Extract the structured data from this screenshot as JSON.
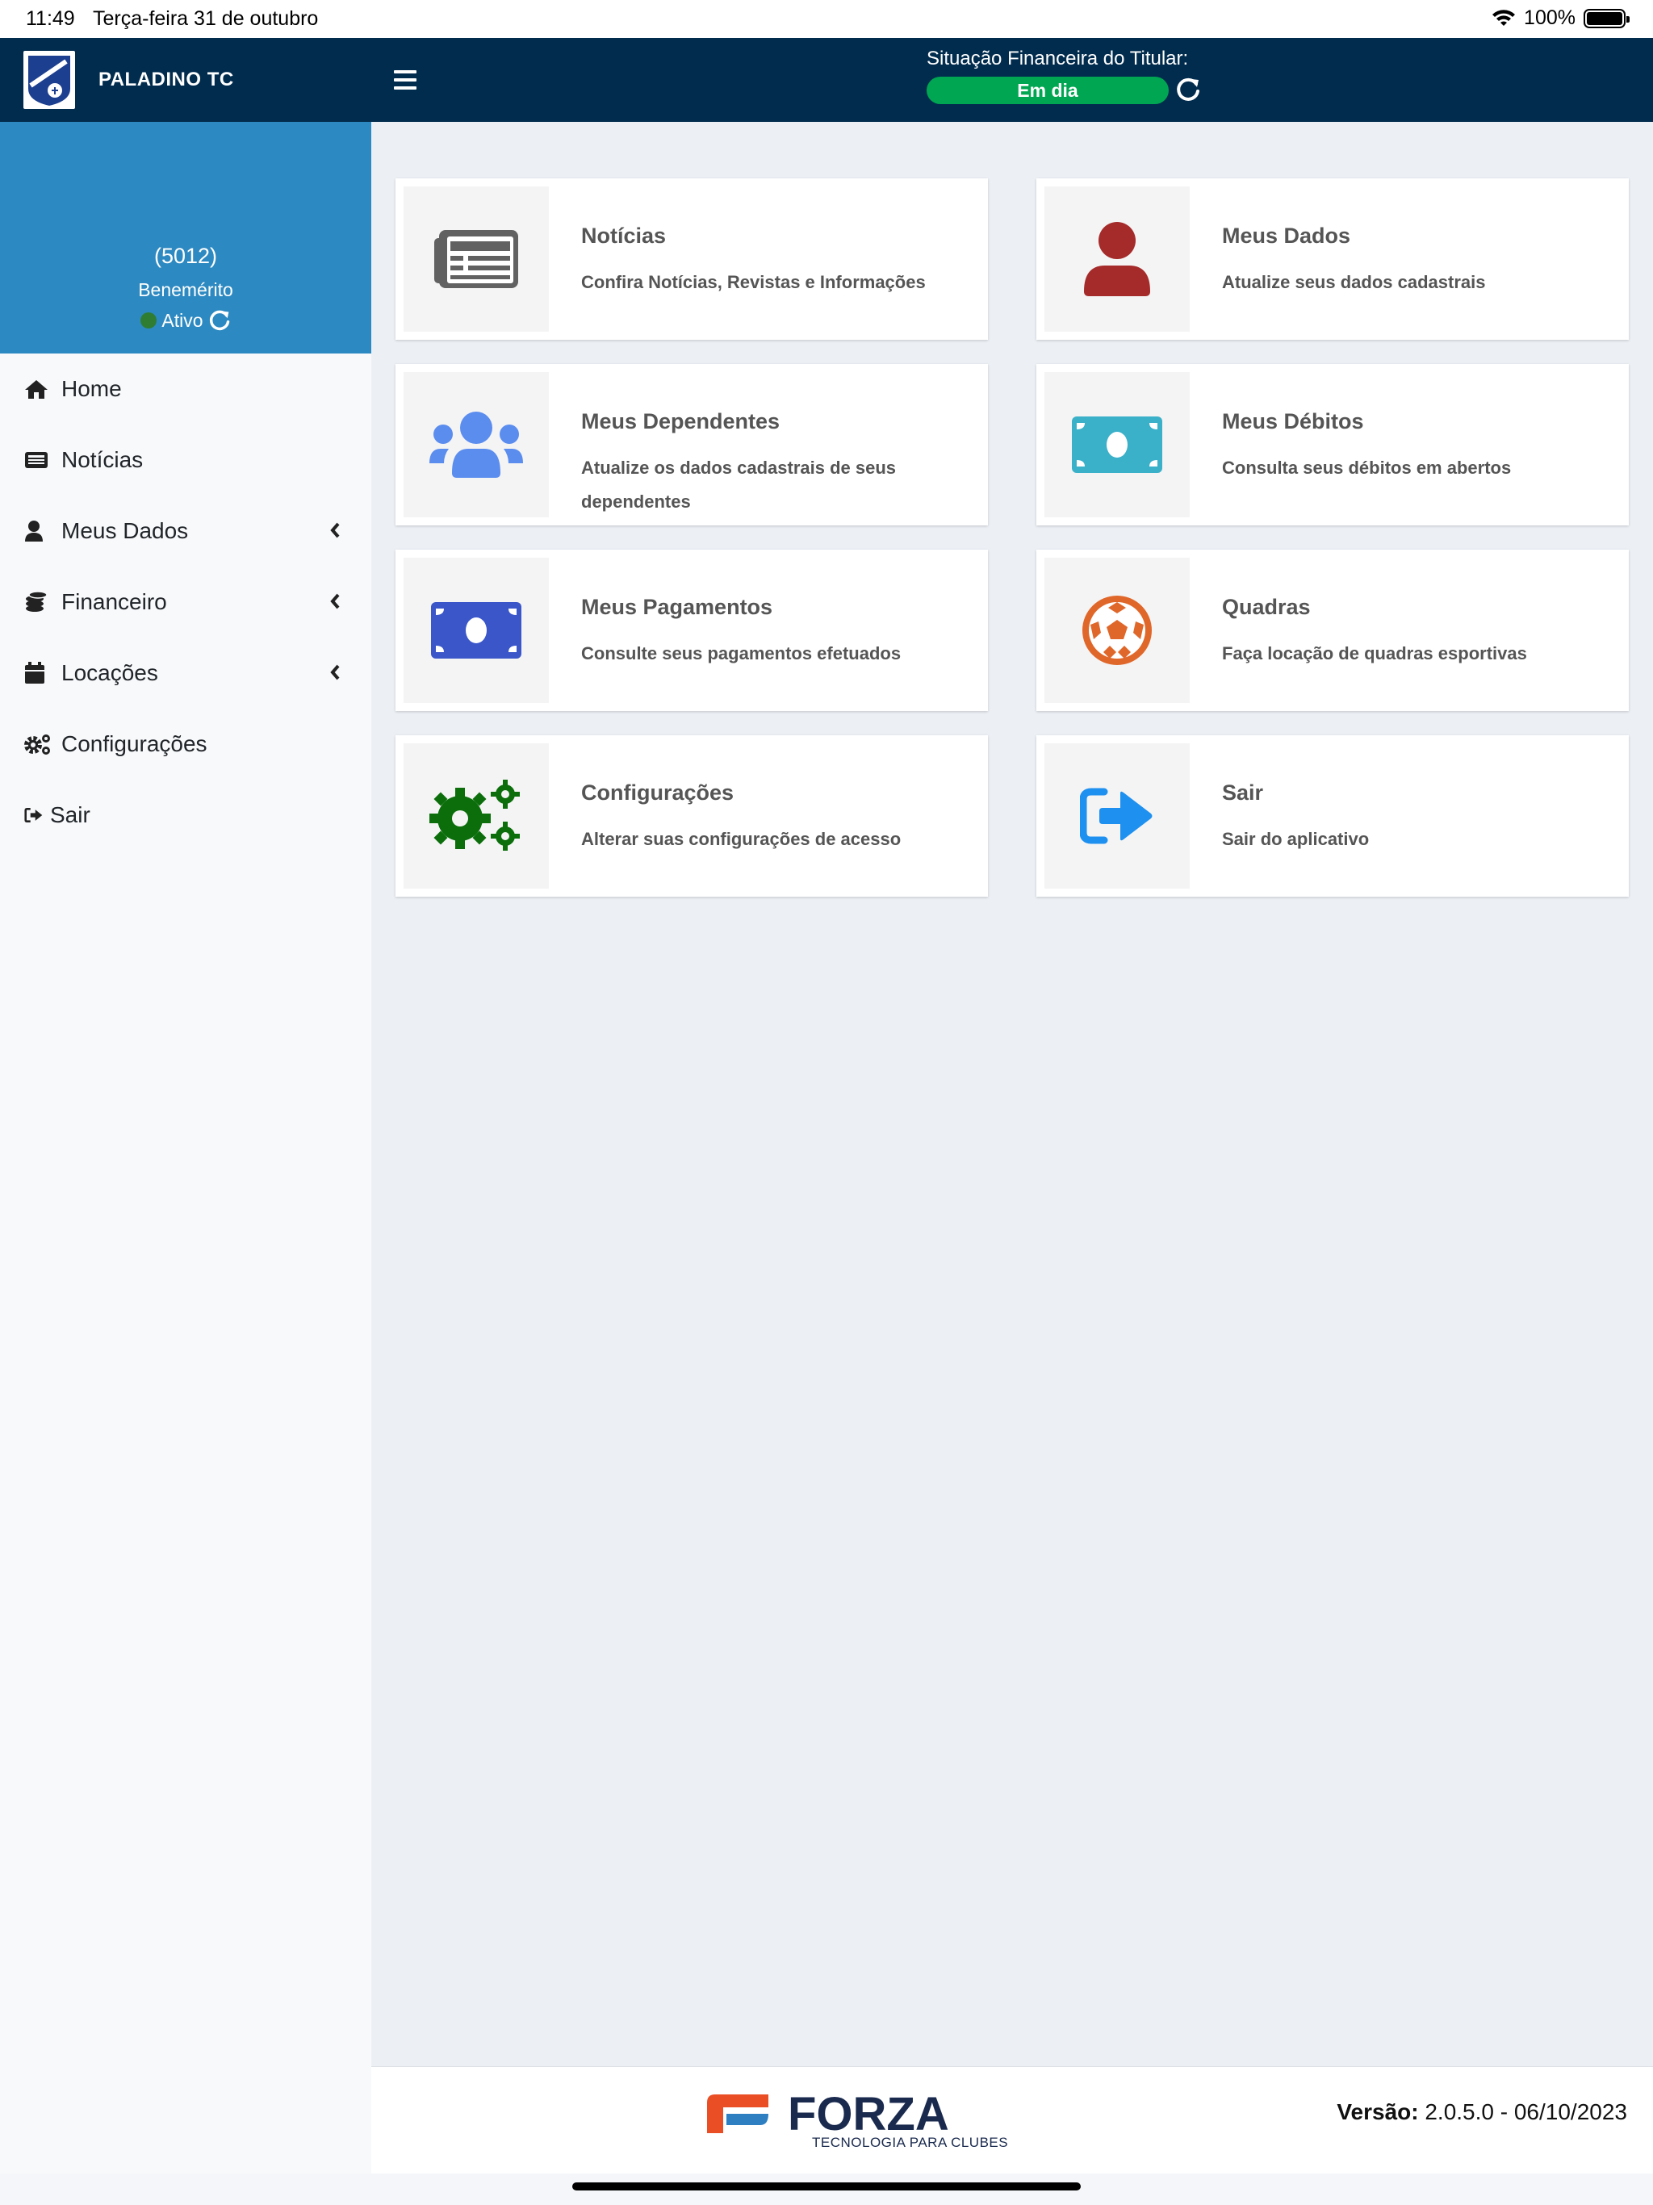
{
  "statusbar": {
    "time": "11:49",
    "date": "Terça-feira 31 de outubro",
    "battery": "100%"
  },
  "navbar": {
    "brand": "PALADINO TC",
    "financial_label": "Situação Financeira do Titular:",
    "financial_status": "Em dia"
  },
  "profile": {
    "code": "(5012)",
    "category": "Benemérito",
    "status": "Ativo"
  },
  "menu": [
    {
      "label": "Home",
      "icon": "home-icon"
    },
    {
      "label": "Notícias",
      "icon": "newspaper-icon"
    },
    {
      "label": "Meus Dados",
      "icon": "user-icon"
    },
    {
      "label": "Financeiro",
      "icon": "coins-icon"
    },
    {
      "label": "Locações",
      "icon": "calendar-icon"
    },
    {
      "label": "Configurações",
      "icon": "gears-icon"
    },
    {
      "label": "Sair",
      "icon": "sign-out-icon"
    }
  ],
  "cards": [
    {
      "title": "Notícias",
      "desc": "Confira Notícias, Revistas e Informações",
      "icon": "newspaper-icon",
      "color": "#616161"
    },
    {
      "title": "Meus Dados",
      "desc": "Atualize seus dados cadastrais",
      "icon": "user-icon",
      "color": "#a52a2a"
    },
    {
      "title": "Meus Dependentes",
      "desc": "Atualize os dados cadastrais de seus dependentes",
      "icon": "users-icon",
      "color": "#5b8def"
    },
    {
      "title": "Meus Débitos",
      "desc": "Consulta seus débitos em abertos",
      "icon": "money-bill-icon",
      "color": "#3bb0c9"
    },
    {
      "title": "Meus Pagamentos",
      "desc": "Consulte seus pagamentos efetuados",
      "icon": "money-bill-icon",
      "color": "#3a56c9"
    },
    {
      "title": "Quadras",
      "desc": "Faça locação de quadras esportivas",
      "icon": "soccer-ball-icon",
      "color": "#e0672a"
    },
    {
      "title": "Configurações",
      "desc": "Alterar suas configurações de acesso",
      "icon": "gears-icon",
      "color": "#0b6e0b"
    },
    {
      "title": "Sair",
      "desc": "Sair do aplicativo",
      "icon": "sign-out-icon",
      "color": "#1e90f0"
    }
  ],
  "footer": {
    "brand": "FORZA",
    "tagline": "TECNOLOGIA PARA CLUBES",
    "version_label": "Versão:",
    "version_value": " 2.0.5.0 - 06/10/2023"
  },
  "colors": {
    "navbar": "#022c4e",
    "profile": "#2d89c1",
    "badge": "#00a651"
  }
}
